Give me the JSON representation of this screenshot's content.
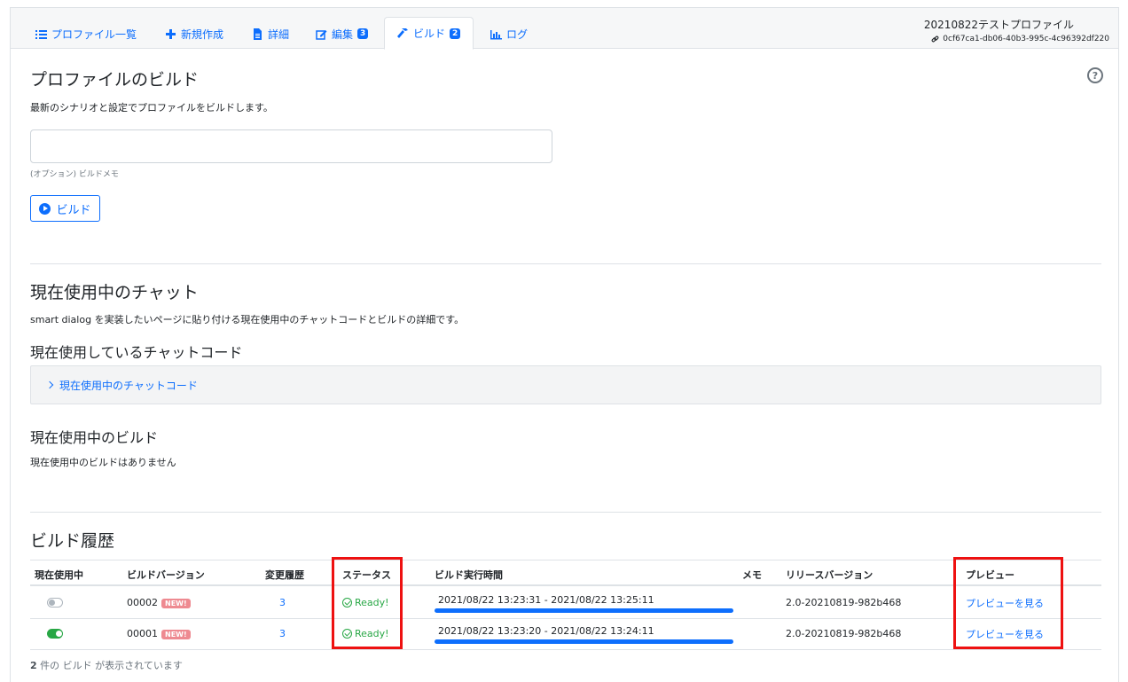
{
  "tabs": [
    {
      "label": "プロファイル一覧",
      "icon": "list-icon"
    },
    {
      "label": "新規作成",
      "icon": "plus-icon"
    },
    {
      "label": "詳細",
      "icon": "document-icon"
    },
    {
      "label": "編集",
      "icon": "edit-icon",
      "badge": "3"
    },
    {
      "label": "ビルド",
      "icon": "hammer-icon",
      "badge": "2",
      "active": true
    },
    {
      "label": "ログ",
      "icon": "chart-icon"
    }
  ],
  "profile": {
    "name": "20210822テストプロファイル",
    "id": "0cf67ca1-db06-40b3-995c-4c96392df220"
  },
  "build_section": {
    "title": "プロファイルのビルド",
    "description": "最新のシナリオと設定でプロファイルをビルドします。",
    "memo_value": "",
    "memo_help": "(オプション) ビルドメモ",
    "button_label": "ビルド"
  },
  "current_chat": {
    "title": "現在使用中のチャット",
    "description": "smart dialog を実装したいページに貼り付ける現在使用中のチャットコードとビルドの詳細です。",
    "code_title": "現在使用しているチャットコード",
    "code_accordion_label": "現在使用中のチャットコード",
    "build_title": "現在使用中のビルド",
    "build_empty": "現在使用中のビルドはありません"
  },
  "history": {
    "title": "ビルド履歴",
    "columns": [
      "現在使用中",
      "ビルドバージョン",
      "変更履歴",
      "ステータス",
      "ビルド実行時間",
      "メモ",
      "リリースバージョン",
      "プレビュー"
    ],
    "rows": [
      {
        "in_use": false,
        "version": "00002",
        "new_badge": "NEW!",
        "changes": "3",
        "status": "Ready!",
        "time": "2021/08/22 13:23:31 - 2021/08/22 13:25:11",
        "memo": "",
        "release": "2.0-20210819-982b468",
        "preview": "プレビューを見る"
      },
      {
        "in_use": true,
        "version": "00001",
        "new_badge": "NEW!",
        "changes": "3",
        "status": "Ready!",
        "time": "2021/08/22 13:23:20 - 2021/08/22 13:24:11",
        "memo": "",
        "release": "2.0-20210819-982b468",
        "preview": "プレビューを見る"
      }
    ],
    "count_number": "2",
    "count_text": " 件の ビルド が表示されています"
  },
  "colors": {
    "primary": "#0d6efd",
    "success": "#28a745",
    "highlight": "#ee1111",
    "new_badge": "#ee8a91"
  }
}
